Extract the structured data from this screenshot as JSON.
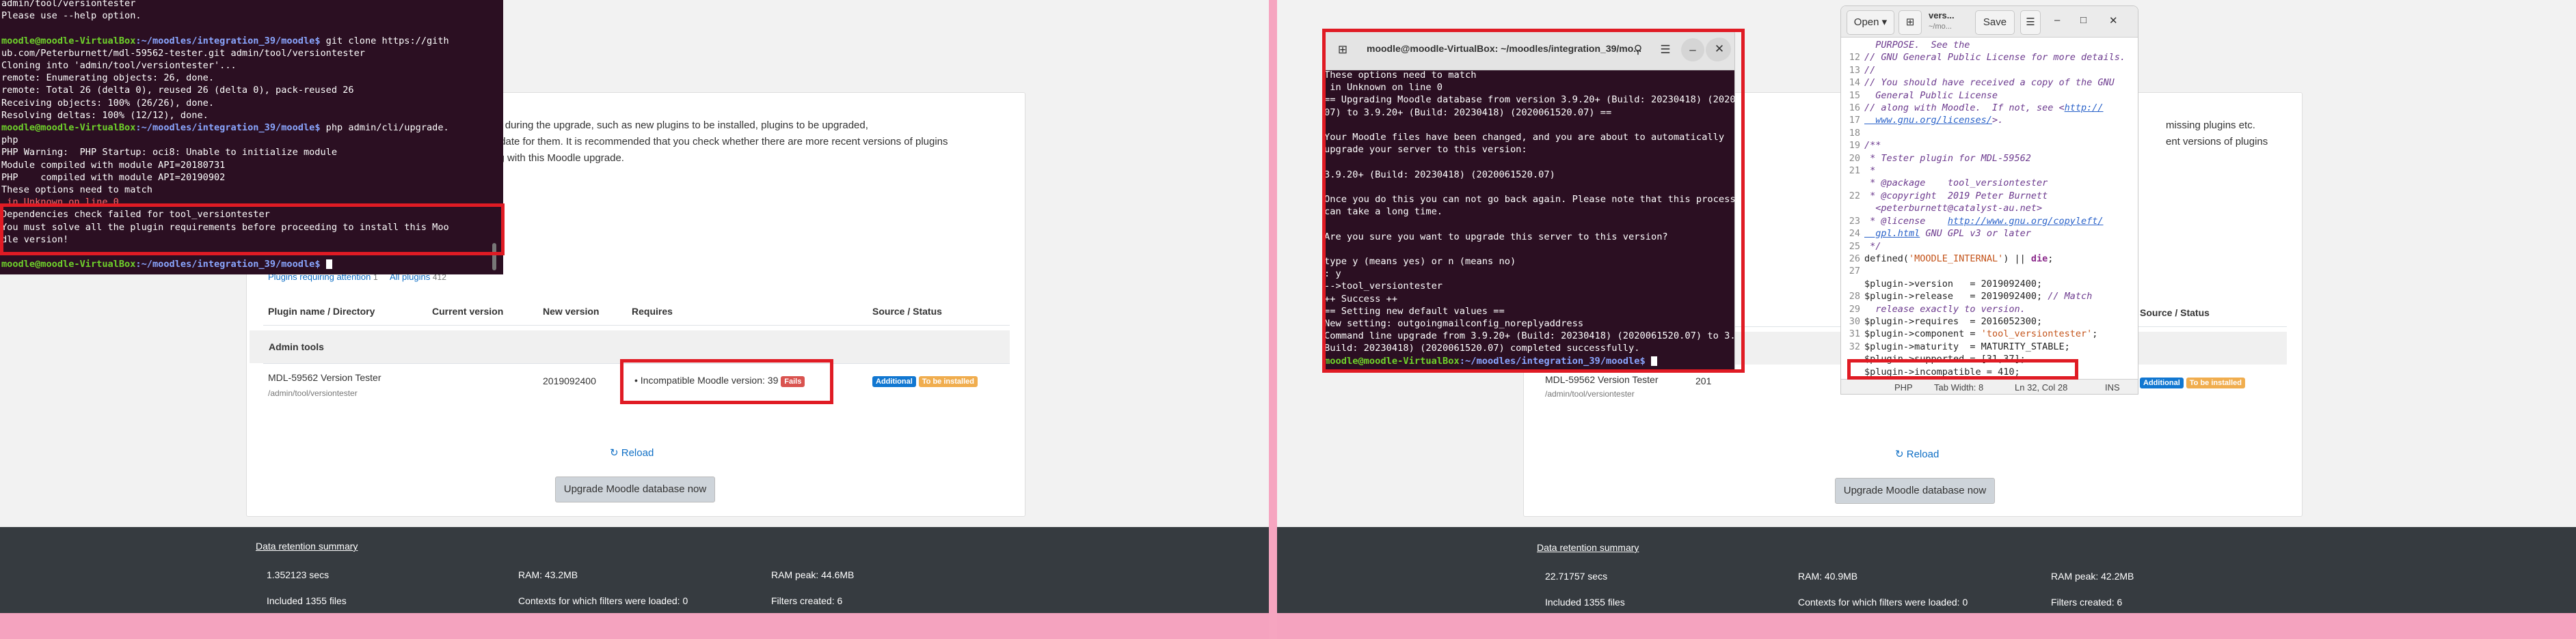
{
  "left": {
    "intro": {
      "line1": "ation during the upgrade, such as new plugins to be installed, plugins to be upgraded,",
      "line2": "e update for them. It is recommended that you check whether there are more recent versions of plugins",
      "line3": "using with this Moodle upgrade."
    },
    "filter": {
      "attention": "Plugins requiring attention",
      "attention_count": "1",
      "all": "All plugins",
      "all_count": "412"
    },
    "table": {
      "headers": [
        "Plugin name / Directory",
        "Current version",
        "New version",
        "Requires",
        "Source / Status"
      ],
      "section": "Admin tools",
      "row": {
        "name": "MDL-59562 Version Tester",
        "dir": "/admin/tool/versiontester",
        "new_version": "2019092400",
        "requires": "Incompatible Moodle version: 39",
        "requires_badge": "Fails",
        "source_badge": "Additional",
        "status_badge": "To be installed"
      }
    },
    "reload": "Reload",
    "upgrade_button": "Upgrade Moodle database now",
    "footer": {
      "link": "Data retention summary",
      "time": "1.352123 secs",
      "ram": "RAM: 43.2MB",
      "ram_peak": "RAM peak: 44.6MB",
      "files": "Included 1355 files",
      "contexts": "Contexts for which filters were loaded: 0",
      "filters": "Filters created: 6"
    },
    "terminal": {
      "l1": "admin/tool/versiontester",
      "l2": "Please use --help option.",
      "p1_user": "moodle@moodle-VirtualBox",
      "p1_path": ":~/moodles/integration_39/moodle$",
      "p1_cmd": " git clone https://gith",
      "l3": "ub.com/Peterburnett/mdl-59562-tester.git admin/tool/versiontester",
      "l4": "Cloning into 'admin/tool/versiontester'...",
      "l5": "remote: Enumerating objects: 26, done.",
      "l6": "remote: Total 26 (delta 0), reused 26 (delta 0), pack-reused 26",
      "l7": "Receiving objects: 100% (26/26), done.",
      "l8": "Resolving deltas: 100% (12/12), done.",
      "p2_user": "moodle@moodle-VirtualBox",
      "p2_path": ":~/moodles/integration_39/moodle$",
      "p2_cmd": " php admin/cli/upgrade.",
      "l9": "php",
      "l10": "PHP Warning:  PHP Startup: oci8: Unable to initialize module",
      "l11": "Module compiled with module API=20180731",
      "l12": "PHP    compiled with module API=20190902",
      "l13": "These options need to match",
      "l14": " in Unknown on line 0",
      "l15": "Dependencies check failed for tool_versiontester",
      "l16": "You must solve all the plugin requirements before proceeding to install this Moo",
      "l17": "dle version!",
      "p3_user": "moodle@moodle-VirtualBox",
      "p3_path": ":~/moodles/integration_39/moodle$"
    }
  },
  "right": {
    "intro": {
      "line1": "missing plugins etc.",
      "line2": "ent versions of plugins"
    },
    "table": {
      "headers": [
        "Source / Status"
      ],
      "row": {
        "name": "MDL-59562 Version Tester",
        "dir": "/admin/tool/versiontester",
        "new_version_partial": "201",
        "source_badge": "Additional",
        "status_badge": "To be installed"
      }
    },
    "reload": "Reload",
    "upgrade_button": "Upgrade Moodle database now",
    "footer": {
      "link": "Data retention summary",
      "time": "22.71757 secs",
      "ram": "RAM: 40.9MB",
      "ram_peak": "RAM peak: 42.2MB",
      "files": "Included 1355 files",
      "contexts": "Contexts for which filters were loaded: 0",
      "filters": "Filters created: 6"
    },
    "terminal": {
      "title": "moodle@moodle-VirtualBox: ~/moodles/integration_39/mo...",
      "l1": "These options need to match",
      "l2": " in Unknown on line 0",
      "l3": "== Upgrading Moodle database from version 3.9.20+ (Build: 20230418) (2020061520.",
      "l4": "07) to 3.9.20+ (Build: 20230418) (2020061520.07) ==",
      "l5": "",
      "l6": "Your Moodle files have been changed, and you are about to automatically",
      "l7": "upgrade your server to this version:",
      "l8": "",
      "l9": "3.9.20+ (Build: 20230418) (2020061520.07)",
      "l10": "",
      "l11": "Once you do this you can not go back again. Please note that this process",
      "l12": "can take a long time.",
      "l13": "",
      "l14": "Are you sure you want to upgrade this server to this version?",
      "l15": "",
      "l16": "type y (means yes) or n (means no)",
      "l17": ": y",
      "l18": "-->tool_versiontester",
      "l19": "++ Success ++",
      "l20": "== Setting new default values ==",
      "l21": "New setting: outgoingmailconfig_noreplyaddress",
      "l22": "Command line upgrade from 3.9.20+ (Build: 20230418) (2020061520.07) to 3.9.20+ (",
      "l23": "Build: 20230418) (2020061520.07) completed successfully.",
      "p_user": "moodle@moodle-VirtualBox",
      "p_path": ":~/moodles/integration_39/moodle$"
    },
    "editor": {
      "open": "Open",
      "title": "vers...",
      "subtitle": "~/mo...",
      "save": "Save",
      "status_lang": "PHP",
      "status_tab": "Tab Width: 8",
      "status_pos": "Ln 32, Col 28",
      "status_ins": "INS",
      "line_numbers": [
        "",
        "12",
        "13",
        "14",
        "15",
        "16",
        "17",
        "18",
        "19",
        "20",
        "21",
        "",
        "22",
        "",
        "23",
        "24",
        "25",
        "26",
        "27",
        "",
        "28",
        "29",
        "30",
        "31",
        "32"
      ],
      "c1": "  PURPOSE.  See the",
      "c12": "// GNU General Public License for more details.",
      "c13": "//",
      "c14a": "// You should have received a copy of the GNU",
      "c14b": "  General Public License",
      "c15a": "// along with Moodle.  If not, see <",
      "c15b": "http://",
      "c15c": "  www.gnu.org/licenses/",
      "c15d": ">.",
      "c17": "/**",
      "c18": " * Tester plugin for MDL-59562",
      "c19": " *",
      "c20": " * @package    tool_versiontester",
      "c21a": " * @copyright  2019 Peter Burnett",
      "c21b": "  <peterburnett@catalyst-au.net>",
      "c22a": " * @license    ",
      "c22b": "http://www.gnu.org/copyleft/",
      "c22c": "  gpl.html",
      "c22d": " GNU GPL v3 or later",
      "c23": " */",
      "c24a": "defined(",
      "c24b": "'MOODLE_INTERNAL'",
      "c24c": ") || ",
      "c24d": "die",
      "c24e": ";",
      "c26": "$plugin->version   = 2019092400;",
      "c27a": "$plugin->release   = 2019092400; ",
      "c27b": "// Match",
      "c27c": "  release exactly to version.",
      "c28": "$plugin->requires  = 2016052300;",
      "c29a": "$plugin->component = ",
      "c29b": "'tool_versiontester'",
      "c29c": ";",
      "c30": "$plugin->maturity  = MATURITY_STABLE;",
      "c31": "$plugin->supported = [31,37];",
      "c32": "$plugin->incompatible = 410;"
    }
  }
}
